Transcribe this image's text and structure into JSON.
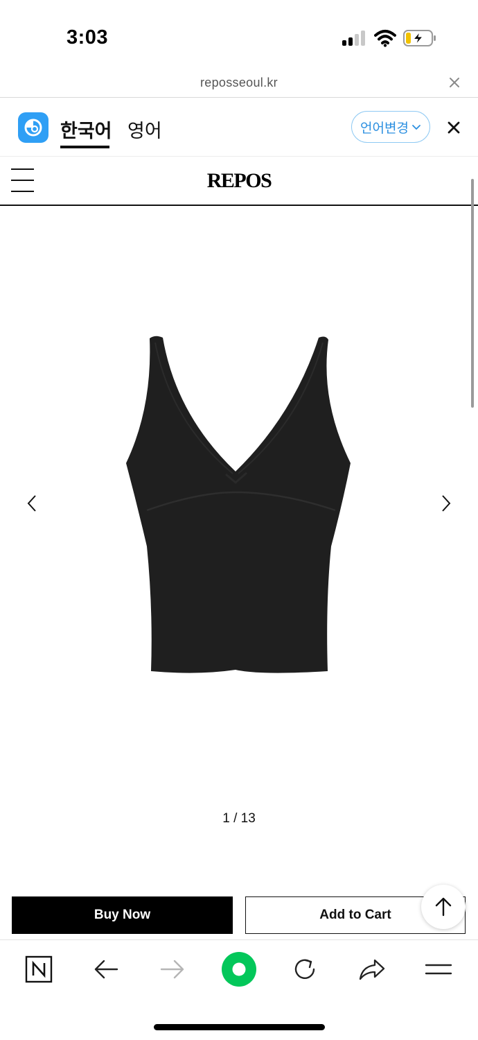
{
  "status_bar": {
    "time": "3:03",
    "signal_icon": "cellular-signal-icon",
    "wifi_icon": "wifi-icon",
    "battery_icon": "battery-charging-icon"
  },
  "browser": {
    "url": "reposseoul.kr",
    "close_icon": "close-icon"
  },
  "translate_bar": {
    "app_icon": "translate-app-icon",
    "source_language": "한국어",
    "target_language": "영어",
    "change_language_label": "언어변경",
    "accent_color": "#2f9ff5",
    "close_icon": "close-icon"
  },
  "site_header": {
    "menu_icon": "hamburger-menu-icon",
    "logo": "REPOS"
  },
  "product_gallery": {
    "image": "black-v-neck-tank-top",
    "prev_icon": "chevron-left-icon",
    "next_icon": "chevron-right-icon",
    "counter": "1 / 13"
  },
  "actions": {
    "buy_now_label": "Buy Now",
    "add_to_cart_label": "Add to Cart",
    "scroll_top_icon": "arrow-up-icon"
  },
  "toolbar": {
    "items": [
      {
        "icon": "naver-home-icon"
      },
      {
        "icon": "back-arrow-icon"
      },
      {
        "icon": "forward-arrow-icon"
      },
      {
        "icon": "green-dot-icon"
      },
      {
        "icon": "refresh-icon"
      },
      {
        "icon": "share-icon"
      },
      {
        "icon": "menu-icon"
      }
    ],
    "green_color": "#03c75a"
  }
}
